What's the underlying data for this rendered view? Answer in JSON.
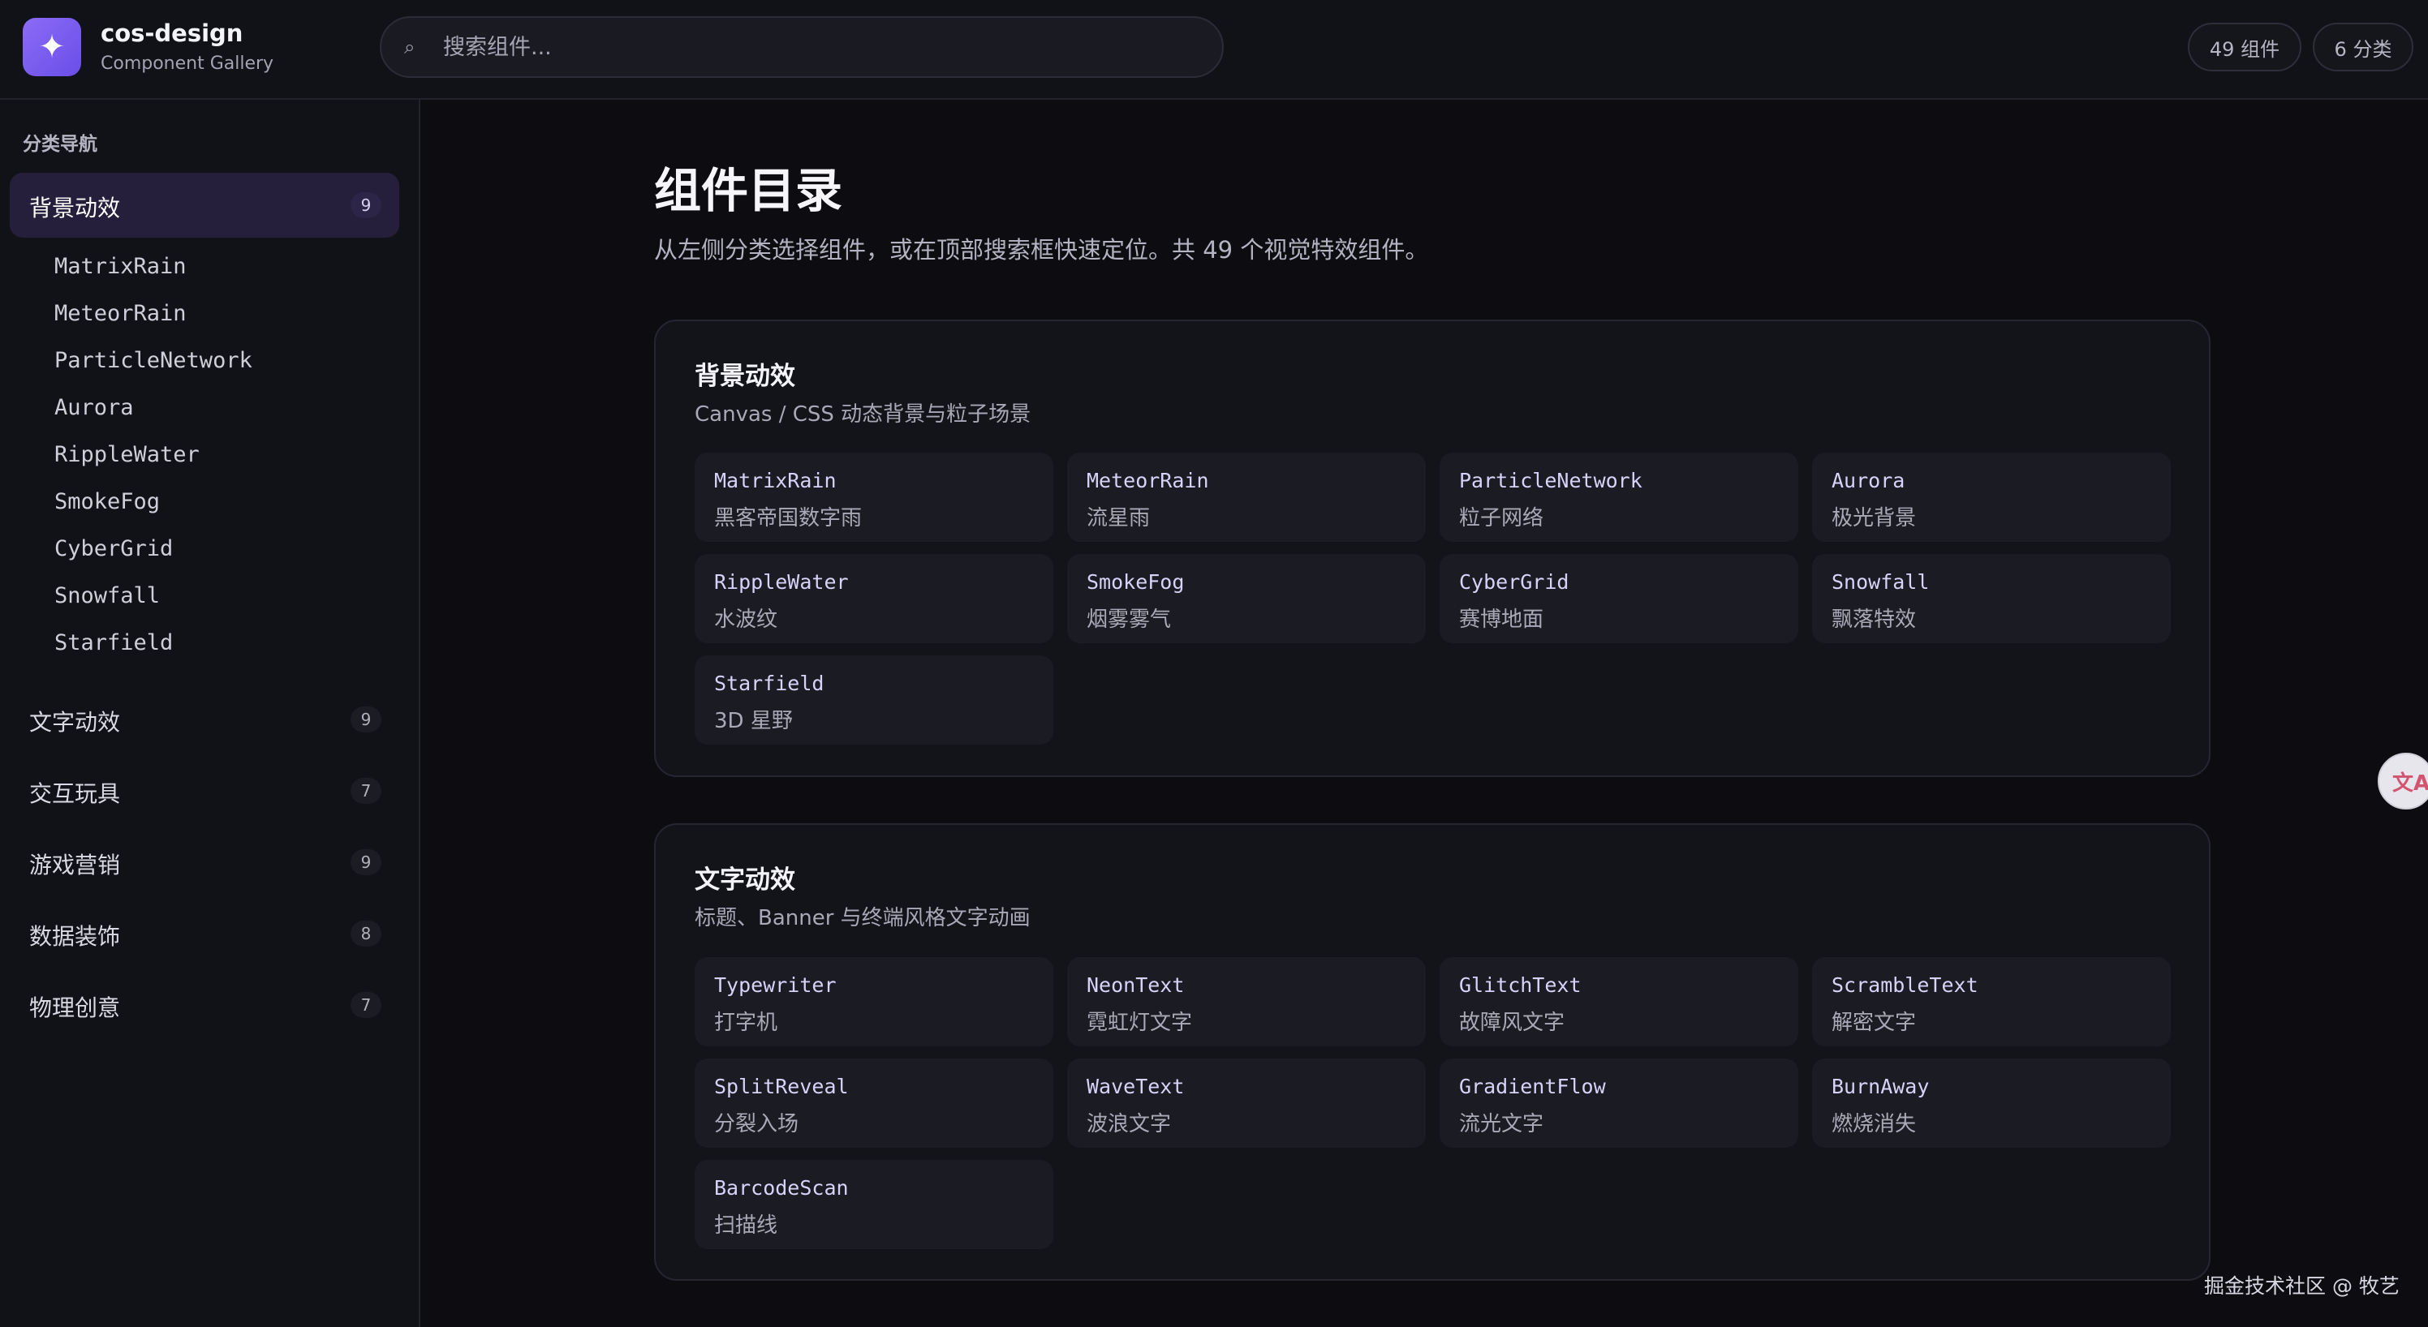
{
  "header": {
    "logo_glyph": "✦",
    "brand_name": "cos-design",
    "brand_sub": "Component Gallery",
    "search_icon": "⌕",
    "search_placeholder": "搜索组件...",
    "stat_components": "49 组件",
    "stat_categories": "6 分类"
  },
  "sidebar": {
    "heading": "分类导航",
    "categories": [
      {
        "label": "背景动效",
        "count": "9",
        "active": true,
        "items": [
          "MatrixRain",
          "MeteorRain",
          "ParticleNetwork",
          "Aurora",
          "RippleWater",
          "SmokeFog",
          "CyberGrid",
          "Snowfall",
          "Starfield"
        ]
      },
      {
        "label": "文字动效",
        "count": "9"
      },
      {
        "label": "交互玩具",
        "count": "7"
      },
      {
        "label": "游戏营销",
        "count": "9"
      },
      {
        "label": "数据装饰",
        "count": "8"
      },
      {
        "label": "物理创意",
        "count": "7"
      }
    ]
  },
  "main": {
    "title": "组件目录",
    "desc": "从左侧分类选择组件，或在顶部搜索框快速定位。共 49 个视觉特效组件。",
    "sections": [
      {
        "title": "背景动效",
        "desc": "Canvas / CSS 动态背景与粒子场景",
        "cards": [
          {
            "name": "MatrixRain",
            "cn": "黑客帝国数字雨"
          },
          {
            "name": "MeteorRain",
            "cn": "流星雨"
          },
          {
            "name": "ParticleNetwork",
            "cn": "粒子网络"
          },
          {
            "name": "Aurora",
            "cn": "极光背景"
          },
          {
            "name": "RippleWater",
            "cn": "水波纹"
          },
          {
            "name": "SmokeFog",
            "cn": "烟雾雾气"
          },
          {
            "name": "CyberGrid",
            "cn": "赛博地面"
          },
          {
            "name": "Snowfall",
            "cn": "飘落特效"
          },
          {
            "name": "Starfield",
            "cn": "3D 星野"
          }
        ]
      },
      {
        "title": "文字动效",
        "desc": "标题、Banner 与终端风格文字动画",
        "cards": [
          {
            "name": "Typewriter",
            "cn": "打字机"
          },
          {
            "name": "NeonText",
            "cn": "霓虹灯文字"
          },
          {
            "name": "GlitchText",
            "cn": "故障风文字"
          },
          {
            "name": "ScrambleText",
            "cn": "解密文字"
          },
          {
            "name": "SplitReveal",
            "cn": "分裂入场"
          },
          {
            "name": "WaveText",
            "cn": "波浪文字"
          },
          {
            "name": "GradientFlow",
            "cn": "流光文字"
          },
          {
            "name": "BurnAway",
            "cn": "燃烧消失"
          },
          {
            "name": "BarcodeScan",
            "cn": "扫描线"
          }
        ]
      }
    ]
  },
  "float_button": {
    "icon": "translate-icon",
    "glyph": "文A"
  },
  "watermark": "掘金技术社区 @ 牧艺",
  "colors": {
    "accent": "#7c5cf0",
    "background": "#0c0c11",
    "panel": "#111118",
    "card": "#1b1b23"
  }
}
